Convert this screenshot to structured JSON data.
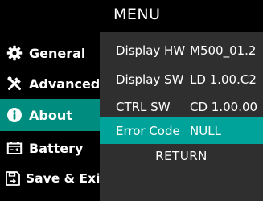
{
  "header": {
    "title": "MENU"
  },
  "sidebar": {
    "items": [
      {
        "label": "General",
        "icon": "gear-icon"
      },
      {
        "label": "Advanced",
        "icon": "tools-icon"
      },
      {
        "label": "About",
        "icon": "info-icon",
        "active": true
      },
      {
        "label": "Battery",
        "icon": "battery-icon"
      },
      {
        "label": "Save & Exit",
        "icon": "save-icon"
      }
    ]
  },
  "panel": {
    "rows": [
      {
        "label": "Display HW",
        "value": "M500_01.2"
      },
      {
        "label": "Display SW",
        "value": "LD 1.00.C2"
      },
      {
        "label": "CTRL SW",
        "value": "CD 1.00.00"
      },
      {
        "label": "Error Code",
        "value": "NULL",
        "highlighted": true
      }
    ],
    "return_label": "RETURN"
  },
  "colors": {
    "background": "#000000",
    "panel": "#2f2f2f",
    "active_sidebar": "#008d7f",
    "highlight_row": "#00a39a",
    "text": "#ffffff"
  }
}
